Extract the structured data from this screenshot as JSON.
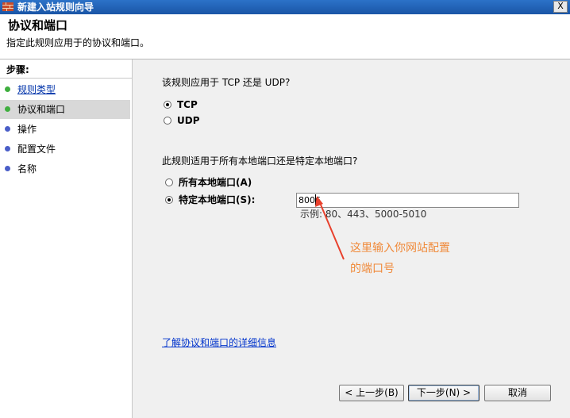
{
  "window": {
    "title": "新建入站规则向导",
    "close_glyph": "X"
  },
  "header": {
    "title": "协议和端口",
    "subtitle": "指定此规则应用于的协议和端口。"
  },
  "steps": {
    "heading": "步骤:",
    "items": [
      {
        "label": "规则类型",
        "color": "#3fae3f",
        "state": "done"
      },
      {
        "label": "协议和端口",
        "color": "#3fae3f",
        "state": "current"
      },
      {
        "label": "操作",
        "color": "#4a5ec8",
        "state": "pending"
      },
      {
        "label": "配置文件",
        "color": "#4a5ec8",
        "state": "pending"
      },
      {
        "label": "名称",
        "color": "#4a5ec8",
        "state": "pending"
      }
    ]
  },
  "protocol": {
    "question": "该规则应用于 TCP 还是 UDP?",
    "options": [
      {
        "label": "TCP",
        "checked": true
      },
      {
        "label": "UDP",
        "checked": false
      }
    ]
  },
  "ports": {
    "question": "此规则适用于所有本地端口还是特定本地端口?",
    "options": [
      {
        "label": "所有本地端口(A)",
        "checked": false
      },
      {
        "label": "特定本地端口(S):",
        "checked": true
      }
    ],
    "value": "8006",
    "example": "示例: 80、443、5000-5010"
  },
  "annotation": {
    "line1": "这里输入你网站配置",
    "line2": "的端口号",
    "color": "#f08a3a"
  },
  "link": {
    "label": "了解协议和端口的详细信息"
  },
  "buttons": {
    "back": "< 上一步(B)",
    "next": "下一步(N) >",
    "cancel": "取消"
  }
}
